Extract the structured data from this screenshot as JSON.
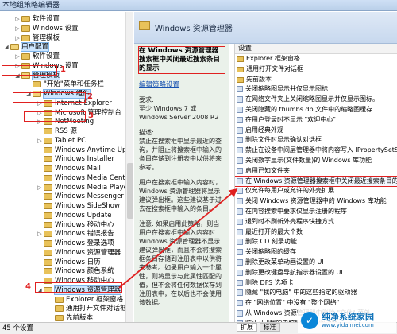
{
  "window": {
    "title": "本地组策略编辑器"
  },
  "tree": [
    {
      "label": "软件设置",
      "indent": 1,
      "arrow": "▷",
      "hl": false
    },
    {
      "label": "Windows 设置",
      "indent": 1,
      "arrow": "▷",
      "hl": false
    },
    {
      "label": "管理模板",
      "indent": 1,
      "arrow": "▷",
      "hl": false
    },
    {
      "label": "用户配置",
      "indent": 0,
      "arrow": "◢",
      "hl": true
    },
    {
      "label": "软件设置",
      "indent": 1,
      "arrow": "▷",
      "hl": false
    },
    {
      "label": "Windows 设置",
      "indent": 1,
      "arrow": "▷",
      "hl": false
    },
    {
      "label": "管理模板",
      "indent": 1,
      "arrow": "◢",
      "hl": true
    },
    {
      "label": "\"开始\"菜单和任务栏",
      "indent": 2,
      "arrow": "",
      "hl": false
    },
    {
      "label": "Windows 组件",
      "indent": 2,
      "arrow": "◢",
      "hl": true
    },
    {
      "label": "Internet Explorer",
      "indent": 3,
      "arrow": "▷",
      "hl": false
    },
    {
      "label": "Microsoft 管理控制台",
      "indent": 3,
      "arrow": "▷",
      "hl": false
    },
    {
      "label": "NetMeeting",
      "indent": 3,
      "arrow": "▷",
      "hl": false
    },
    {
      "label": "RSS 源",
      "indent": 3,
      "arrow": "",
      "hl": false
    },
    {
      "label": "Tablet PC",
      "indent": 3,
      "arrow": "▷",
      "hl": false
    },
    {
      "label": "Windows Anytime Upgrade",
      "indent": 3,
      "arrow": "",
      "hl": false
    },
    {
      "label": "Windows Installer",
      "indent": 3,
      "arrow": "",
      "hl": false
    },
    {
      "label": "Windows Mail",
      "indent": 3,
      "arrow": "",
      "hl": false
    },
    {
      "label": "Windows Media Center",
      "indent": 3,
      "arrow": "",
      "hl": false
    },
    {
      "label": "Windows Media Player",
      "indent": 3,
      "arrow": "▷",
      "hl": false
    },
    {
      "label": "Windows Messenger",
      "indent": 3,
      "arrow": "",
      "hl": false
    },
    {
      "label": "Windows SideShow",
      "indent": 3,
      "arrow": "",
      "hl": false
    },
    {
      "label": "Windows Update",
      "indent": 3,
      "arrow": "",
      "hl": false
    },
    {
      "label": "Windows 移动中心",
      "indent": 3,
      "arrow": "",
      "hl": false
    },
    {
      "label": "Windows 错误报告",
      "indent": 3,
      "arrow": "▷",
      "hl": false
    },
    {
      "label": "Windows 登录选项",
      "indent": 3,
      "arrow": "",
      "hl": false
    },
    {
      "label": "Windows 资源管理器",
      "indent": 3,
      "arrow": "",
      "hl": false
    },
    {
      "label": "Windows 日历",
      "indent": 3,
      "arrow": "",
      "hl": false
    },
    {
      "label": "Windows 颜色系统",
      "indent": 3,
      "arrow": "",
      "hl": false
    },
    {
      "label": "Windows 移动中心",
      "indent": 3,
      "arrow": "",
      "hl": false
    },
    {
      "label": "Windows 资源管理器",
      "indent": 3,
      "arrow": "◢",
      "hl": true
    },
    {
      "label": "Explorer 框架窗格",
      "indent": 4,
      "arrow": "",
      "hl": false
    },
    {
      "label": "通用打开文件对话框",
      "indent": 4,
      "arrow": "",
      "hl": false
    },
    {
      "label": "先前版本",
      "indent": 4,
      "arrow": "",
      "hl": false
    }
  ],
  "annotations": [
    "1",
    "2",
    "3",
    "4"
  ],
  "panel": {
    "header": "Windows 资源管理器"
  },
  "desc": {
    "title": "在 Windows 资源管理器搜索框中关闭最近搜索条目的显示",
    "edit_link": "编辑策略设置",
    "req": "要求:\n至少 Windows 7 或 Windows Server 2008 R2",
    "desc": "描述:\n禁止在搜索框中显示最近的查询，并阻止将搜索框中输入的条目存储到注册表中以供将来参考。",
    "p2": "用户在搜索框中输入内容时，Windows 资源管理器将显示建议弹出框。这些建议基于过去在搜索框中输入的条目。",
    "note": "注意: 如果启用此策略，则当用户在搜索框中输入内容时 Windows 资源管理器不显示建议弹出框，而且不会将搜索框条目存储到注册表中以供将来参考。如果用户输入一个属性，则将显示与此属性匹配的值，但不会将任何数据保存到注册表中，在以后也不会使用该数据。"
  },
  "list": {
    "header": "设置",
    "items": [
      {
        "label": "Explorer 框架窗格",
        "icon": "folder"
      },
      {
        "label": "通用打开文件对话框",
        "icon": "folder"
      },
      {
        "label": "先前版本",
        "icon": "folder"
      },
      {
        "label": "关闭缩略图显示并仅显示图标",
        "icon": "policy"
      },
      {
        "label": "在网络文件夹上关闭缩略图显示并仅显示图标。",
        "icon": "policy"
      },
      {
        "label": "关闭隐藏的 thumbs.db 文件中的缩略图缓存",
        "icon": "policy"
      },
      {
        "label": "在用户登录时不显示 \"欢迎中心\"",
        "icon": "policy"
      },
      {
        "label": "启用经典外观",
        "icon": "policy"
      },
      {
        "label": "删除文件时显示确认对话框",
        "icon": "policy"
      },
      {
        "label": "禁止在设备中间层管理器中将内容写入 IPropertySetStorage",
        "icon": "policy"
      },
      {
        "label": "关闭数字显示(文件数量)的 Windows 库功能",
        "icon": "policy"
      },
      {
        "label": "启用已知文件夹",
        "icon": "policy"
      },
      {
        "label": "在 Windows 资源管理器搜索框中关闭最近搜索条目的显示",
        "icon": "policy",
        "sel": true
      },
      {
        "label": "仅允许每用户或允许的外壳扩展",
        "icon": "policy"
      },
      {
        "label": "关闭 Windows 资源管理器中的 Windows 库功能",
        "icon": "policy"
      },
      {
        "label": "在内容搜索中要求仅显示注册的程序",
        "icon": "policy"
      },
      {
        "label": "退到时不刷新外壳程序快捷方式",
        "icon": "policy"
      },
      {
        "label": "最近打开的最大个数",
        "icon": "policy"
      },
      {
        "label": "删除 CD 刻录功能",
        "icon": "policy"
      },
      {
        "label": "关闭缩略图的缓存",
        "icon": "policy"
      },
      {
        "label": "删除更改菜单动画设置的 UI",
        "icon": "policy"
      },
      {
        "label": "删除更改键盘导航指示器设置的 UI",
        "icon": "policy"
      },
      {
        "label": "删除 DFS 选项卡",
        "icon": "policy"
      },
      {
        "label": "隐藏 \"我的电脑\" 中的这些指定的驱动器",
        "icon": "policy"
      },
      {
        "label": "在 \"网络位置\" 中没有 \"整个网络\"",
        "icon": "policy"
      },
      {
        "label": "从 Windows 资源管理器中删除 \"文件\" 菜单",
        "icon": "policy"
      },
      {
        "label": "防止从 \"我的电脑\" 中访问驱动器",
        "icon": "policy"
      }
    ]
  },
  "status": {
    "text": "45 个设置",
    "tab1": "扩展",
    "tab2": "标准"
  },
  "watermark": {
    "logo": "✓",
    "line1": "纯净系统家园",
    "line2": "www.yidaimei.com"
  }
}
